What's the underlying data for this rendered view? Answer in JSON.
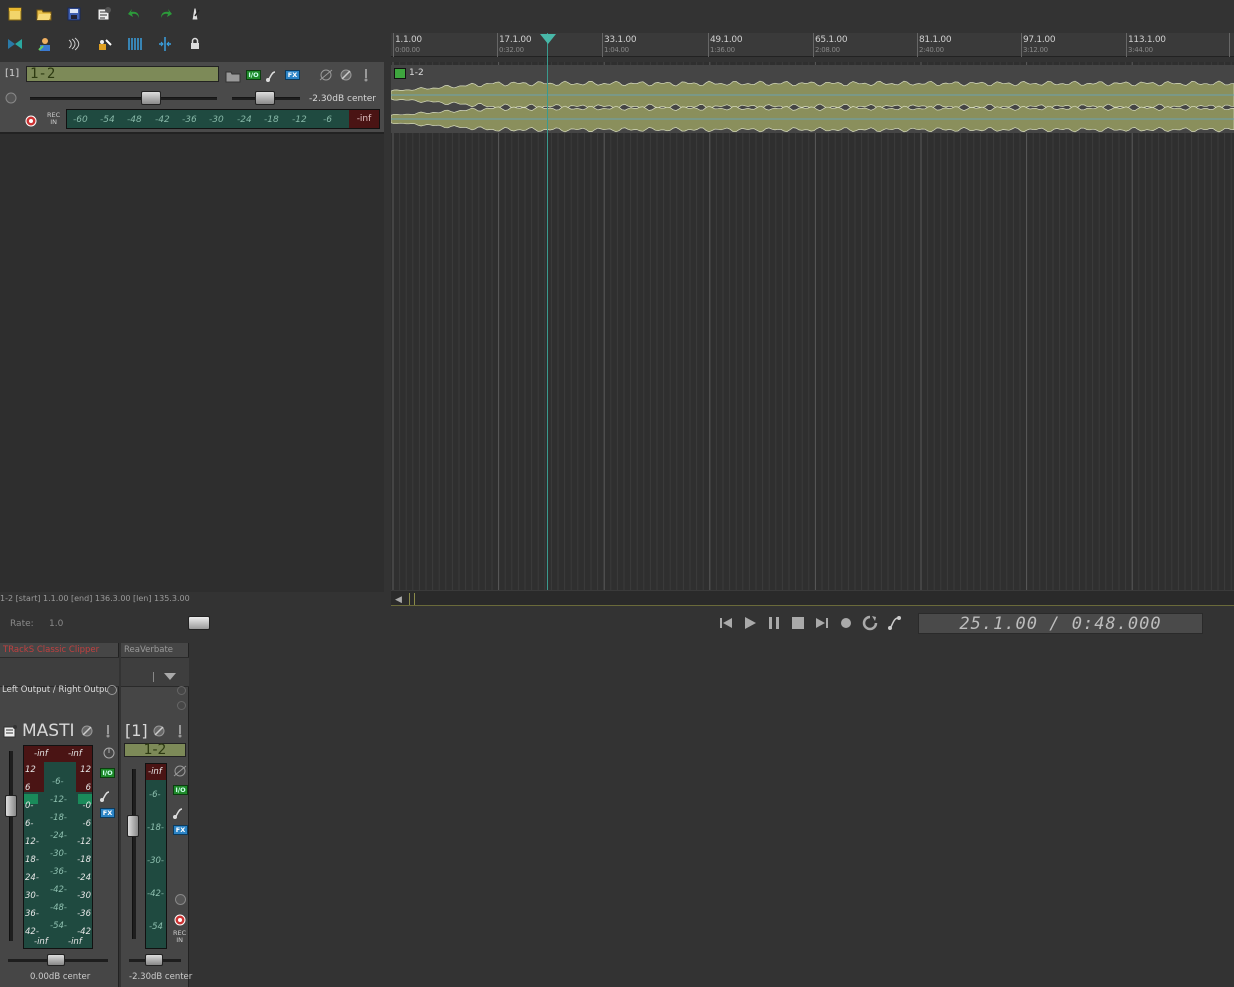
{
  "toolbar": {
    "row1": [
      "new-project-icon",
      "open-project-icon",
      "save-project-icon",
      "project-settings-icon",
      "undo-icon",
      "redo-icon",
      "metronome-icon"
    ],
    "row2": [
      "ripple-edit-icon",
      "envelope-icon",
      "auto-crossfade-icon",
      "lock-settings-icon",
      "snap-grid-icon",
      "split-icon",
      "lock-icon"
    ]
  },
  "tcp": {
    "track_number": "[1]",
    "track_name": "1-2",
    "volume_text": "-2.30dB  center",
    "meter_labels": [
      "-60",
      "-54",
      "-48",
      "-42",
      "-36",
      "-30",
      "-24",
      "-18",
      "-12",
      "-6"
    ],
    "meter_peak": "-inf",
    "rec_in": "REC\nIN",
    "status_line": "1-2 [start] 1.1.00 [end] 136.3.00 [len] 135.3.00"
  },
  "ruler": {
    "marks": [
      {
        "bar": "1.1.00",
        "time": "0:00.00"
      },
      {
        "bar": "17.1.00",
        "time": "0:32.00"
      },
      {
        "bar": "33.1.00",
        "time": "1:04.00"
      },
      {
        "bar": "49.1.00",
        "time": "1:36.00"
      },
      {
        "bar": "65.1.00",
        "time": "2:08.00"
      },
      {
        "bar": "81.1.00",
        "time": "2:40.00"
      },
      {
        "bar": "97.1.00",
        "time": "3:12.00"
      },
      {
        "bar": "113.1.00",
        "time": "3:44.00"
      }
    ]
  },
  "item": {
    "label": "1-2"
  },
  "transport": {
    "rate_label": "Rate:",
    "rate_value": "1.0",
    "time_display": "25.1.00 / 0:48.000"
  },
  "mixer": {
    "master": {
      "fx1": "TRackS Classic Clipper",
      "io": "Left Output / Right Output",
      "name": "MASTI",
      "peak_l": "-inf",
      "peak_r": "-inf",
      "side_scale": [
        "12",
        "6",
        "0-",
        "6-",
        "12-",
        "18-",
        "24-",
        "30-",
        "36-",
        "42-"
      ],
      "side_scale_r": [
        "12",
        "6",
        "-0",
        "-6",
        "-12",
        "-18",
        "-24",
        "-30",
        "-36",
        "-42"
      ],
      "center_scale": [
        "-6-",
        "-12-",
        "-18-",
        "-24-",
        "-30-",
        "-36-",
        "-42-",
        "-48-",
        "-54-"
      ],
      "bottom_l": "-inf",
      "bottom_r": "-inf",
      "volume": "0.00dB  center"
    },
    "track": {
      "fx1": "ReaVerbate",
      "number": "[1]",
      "name": "1-2",
      "peak": "-inf",
      "scale": [
        "-6-",
        "-18-",
        "-30-",
        "-42-",
        "-54"
      ],
      "rec_in": "REC\nIN",
      "volume": "-2.30dB center"
    }
  }
}
